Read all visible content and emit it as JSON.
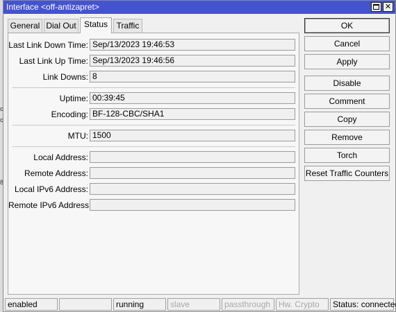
{
  "window": {
    "title": "Interface <off-antizapret>"
  },
  "tabs": [
    {
      "label": "General"
    },
    {
      "label": "Dial Out"
    },
    {
      "label": "Status"
    },
    {
      "label": "Traffic"
    }
  ],
  "status_fields": {
    "last_link_down_time": {
      "label": "Last Link Down Time:",
      "value": "Sep/13/2023 19:46:53"
    },
    "last_link_up_time": {
      "label": "Last Link Up Time:",
      "value": "Sep/13/2023 19:46:56"
    },
    "link_downs": {
      "label": "Link Downs:",
      "value": "8"
    },
    "uptime": {
      "label": "Uptime:",
      "value": "00:39:45"
    },
    "encoding": {
      "label": "Encoding:",
      "value": "BF-128-CBC/SHA1"
    },
    "mtu": {
      "label": "MTU:",
      "value": "1500"
    },
    "local_address": {
      "label": "Local Address:",
      "value": ""
    },
    "remote_address": {
      "label": "Remote Address:",
      "value": ""
    },
    "local_ipv6_address": {
      "label": "Local IPv6 Address:",
      "value": ""
    },
    "remote_ipv6_address": {
      "label": "Remote IPv6 Address:",
      "value": ""
    }
  },
  "buttons": {
    "ok": "OK",
    "cancel": "Cancel",
    "apply": "Apply",
    "disable": "Disable",
    "comment": "Comment",
    "copy": "Copy",
    "remove": "Remove",
    "torch": "Torch",
    "reset_traffic_counters": "Reset Traffic Counters"
  },
  "statusbar": {
    "enabled": "enabled",
    "empty": "",
    "running": "running",
    "slave": "slave",
    "passthrough": "passthrough",
    "hw_crypto": "Hw. Crypto",
    "status": "Status: connected"
  },
  "colors": {
    "titlebar": "#4453d0",
    "window_bg": "#f0f0f0",
    "disabled_text": "#a8a8a8"
  }
}
